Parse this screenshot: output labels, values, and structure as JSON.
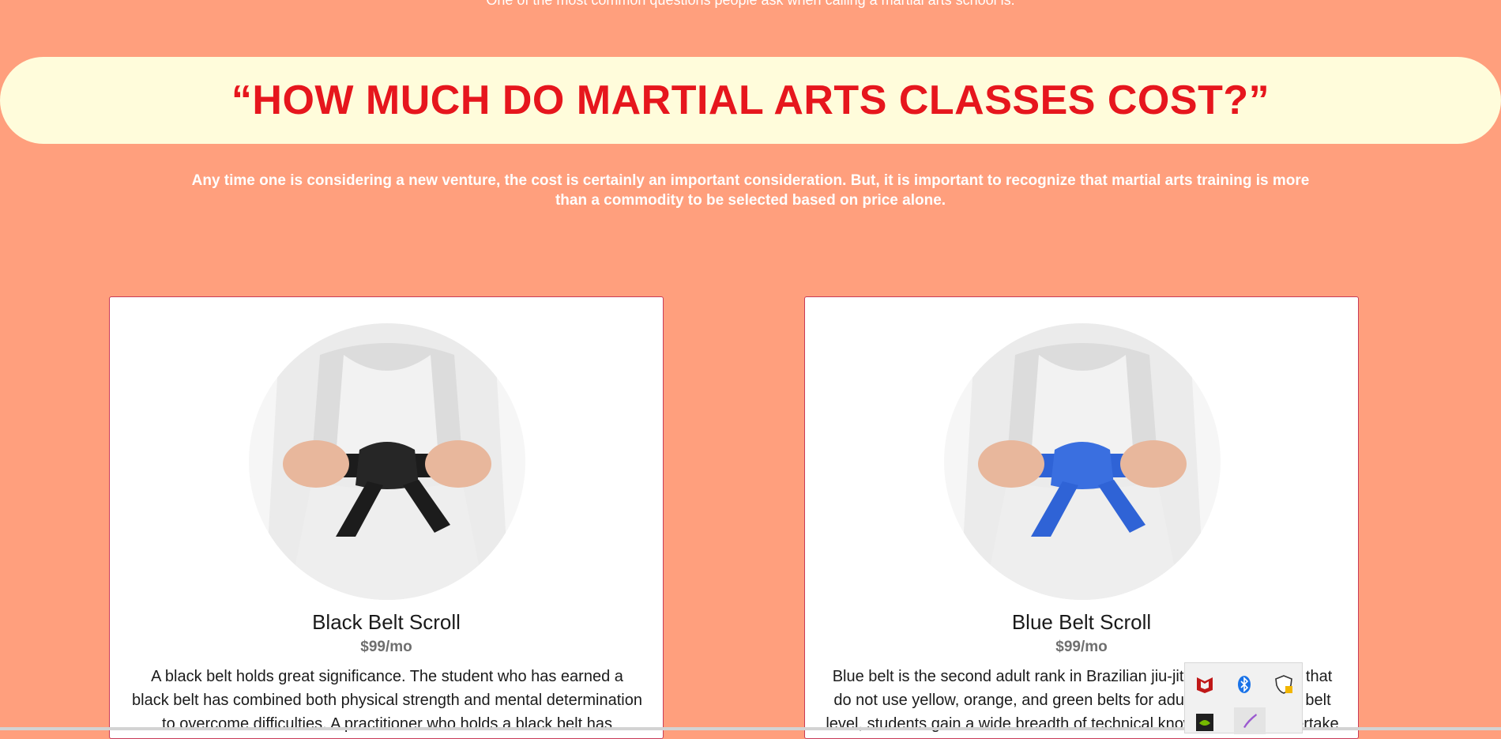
{
  "intro": "One of the most common questions people ask when calling a martial arts school is:",
  "hero": {
    "title": "“HOW MUCH DO MARTIAL ARTS CLASSES COST?”"
  },
  "subtitle": "Any time one is considering a new venture, the cost is certainly an important consideration. But, it is important to recognize that martial arts training is more than a commodity to be selected based on price alone.",
  "cards": [
    {
      "title": "Black Belt Scroll",
      "price": "$99/mo",
      "text": "A black belt holds great significance. The student who has earned a black belt has combined both physical strength and mental determination to overcome difficulties. A practitioner who holds a black belt has",
      "belt_color": "#1c1c1c"
    },
    {
      "title": "Blue Belt Scroll",
      "price": "$99/mo",
      "text": "Blue belt is the second adult rank in Brazilian jiu-jitsu. Most schools that do not use yellow, orange, and green belts for adults.[1] At the blue belt level, students gain a wide breadth of technical knowledge and undertake",
      "belt_color": "#2f63d6"
    }
  ],
  "tray": {
    "icons": [
      "mcafee-icon",
      "bluetooth-icon",
      "security-shield-icon",
      "nvidia-icon",
      "pen-icon"
    ]
  },
  "colors": {
    "background": "#ff9f7d",
    "hero_bg": "#fffcdb",
    "hero_text": "#e6161d"
  }
}
